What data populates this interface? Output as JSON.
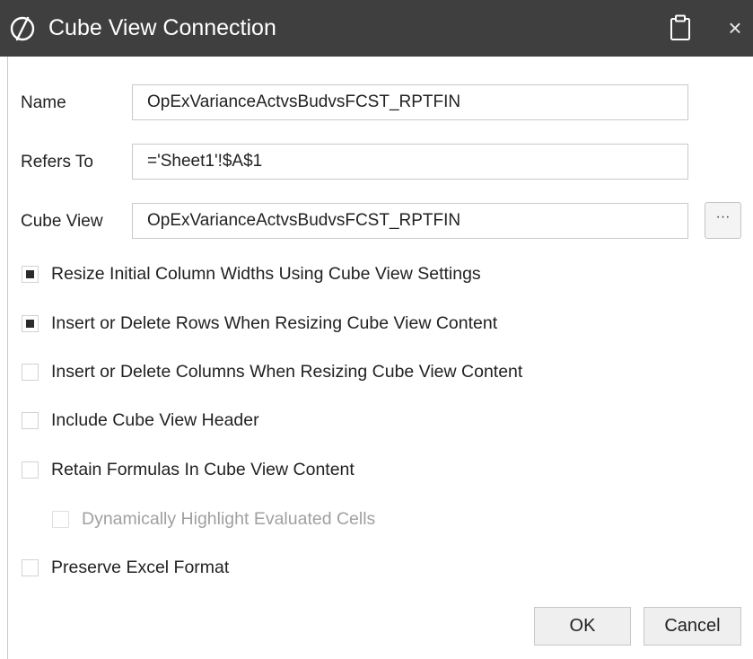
{
  "dialog": {
    "title": "Cube View Connection",
    "icons": {
      "logo": "circle-slash-logo-icon",
      "clipboard": "clipboard-icon",
      "close": "close-icon"
    },
    "close_glyph": "×"
  },
  "form": {
    "name": {
      "label": "Name",
      "value": "OpExVarianceActvsBudvsFCST_RPTFIN"
    },
    "refers_to": {
      "label": "Refers To",
      "value": "='Sheet1'!$A$1"
    },
    "cube_view": {
      "label": "Cube View",
      "value": "OpExVarianceActvsBudvsFCST_RPTFIN",
      "browse_label": "···"
    }
  },
  "options": [
    {
      "label": "Resize Initial Column Widths Using Cube View Settings",
      "checked": true,
      "enabled": true
    },
    {
      "label": "Insert or Delete Rows When Resizing Cube View Content",
      "checked": true,
      "enabled": true
    },
    {
      "label": "Insert or Delete Columns When Resizing Cube View Content",
      "checked": false,
      "enabled": true
    },
    {
      "label": "Include Cube View Header",
      "checked": false,
      "enabled": true
    },
    {
      "label": "Retain Formulas In Cube View Content",
      "checked": false,
      "enabled": true
    },
    {
      "label": "Dynamically Highlight Evaluated Cells",
      "checked": false,
      "enabled": false
    },
    {
      "label": "Preserve Excel Format",
      "checked": false,
      "enabled": true
    }
  ],
  "buttons": {
    "ok": "OK",
    "cancel": "Cancel"
  },
  "colors": {
    "titlebar": "#3f3f3f",
    "checkbox_fill": "#2b2b2b",
    "disabled_text": "#a0a0a0"
  }
}
